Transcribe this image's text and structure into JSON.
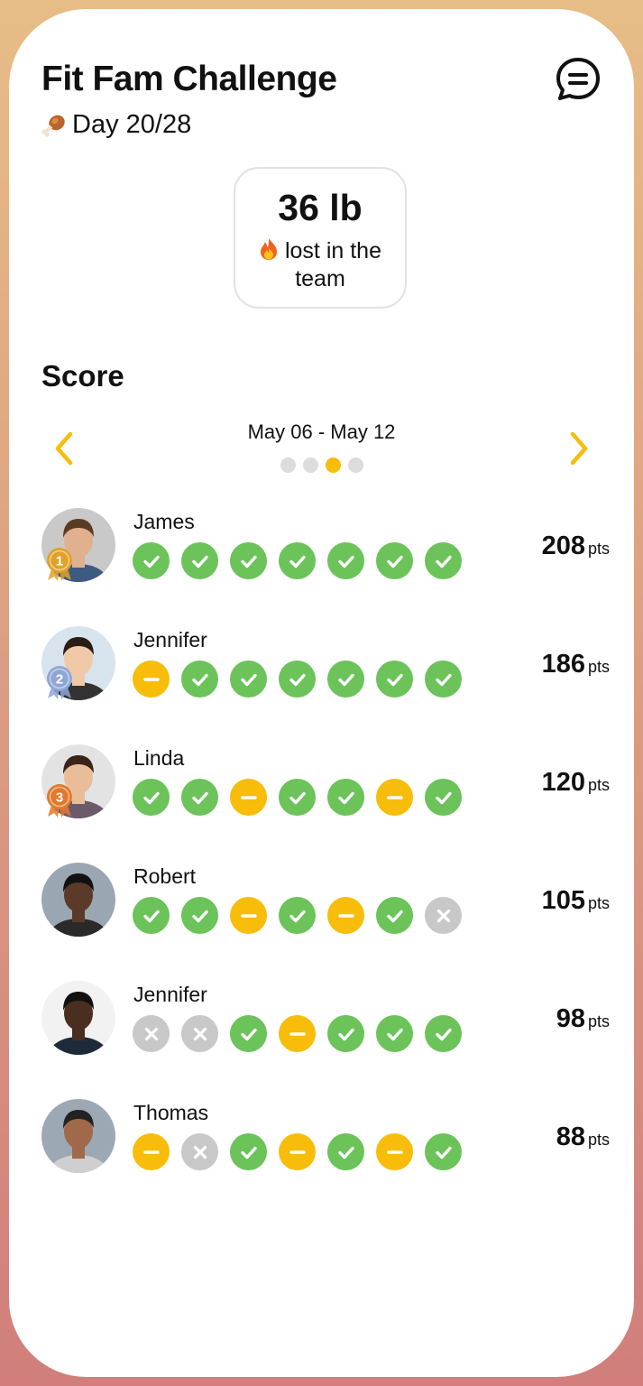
{
  "header": {
    "title": "Fit Fam Challenge",
    "day": "Day 20/28",
    "chat_icon": "chat-bubble-icon",
    "day_icon": "drumstick-icon"
  },
  "stat": {
    "value": "36 lb",
    "label": "lost in the team",
    "icon": "fire-icon"
  },
  "score": {
    "title": "Score",
    "week_range": "May 06 - May 12",
    "active_page": 3,
    "page_count": 4,
    "prev_icon": "chevron-left-icon",
    "next_icon": "chevron-right-icon"
  },
  "colors": {
    "accent": "#f7bd0a",
    "done": "#6bc35a",
    "missed": "#c8c8c8"
  },
  "participants": [
    {
      "name": "James",
      "points": "208",
      "unit": "pts",
      "rank_badge": "1",
      "days": [
        "done",
        "done",
        "done",
        "done",
        "done",
        "done",
        "done"
      ]
    },
    {
      "name": "Jennifer",
      "points": "186",
      "unit": "pts",
      "rank_badge": "2",
      "days": [
        "partial",
        "done",
        "done",
        "done",
        "done",
        "done",
        "done"
      ]
    },
    {
      "name": "Linda",
      "points": "120",
      "unit": "pts",
      "rank_badge": "3",
      "days": [
        "done",
        "done",
        "partial",
        "done",
        "done",
        "partial",
        "done"
      ]
    },
    {
      "name": "Robert",
      "points": "105",
      "unit": "pts",
      "days": [
        "done",
        "done",
        "partial",
        "done",
        "partial",
        "done",
        "missed"
      ]
    },
    {
      "name": "Jennifer",
      "points": "98",
      "unit": "pts",
      "days": [
        "missed",
        "missed",
        "done",
        "partial",
        "done",
        "done",
        "done"
      ]
    },
    {
      "name": "Thomas",
      "points": "88",
      "unit": "pts",
      "days": [
        "partial",
        "missed",
        "done",
        "partial",
        "done",
        "partial",
        "done"
      ]
    }
  ]
}
